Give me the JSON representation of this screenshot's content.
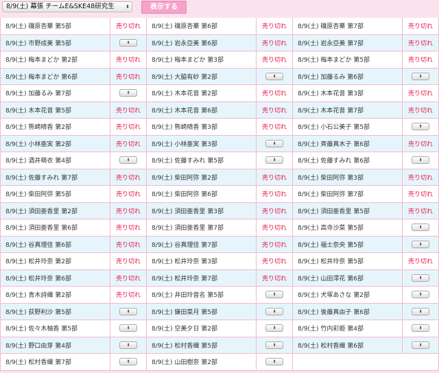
{
  "header": {
    "event_select_value": "8/9(土) 幕張 チームE&SKE48研究生",
    "select_arrow": "⬍",
    "show_button": "表示する"
  },
  "status_labels": {
    "soldout": "売り切れ",
    "select_arrow": "⬍"
  },
  "slots": [
    {
      "label": "8/9(土) 磯原杏華 第5部",
      "status": "soldout"
    },
    {
      "label": "8/9(土) 磯原杏華 第6部",
      "status": "soldout"
    },
    {
      "label": "8/9(土) 磯原杏華 第7部",
      "status": "soldout"
    },
    {
      "label": "8/9(土) 市野成美 第5部",
      "status": "select"
    },
    {
      "label": "8/9(土) 岩永亞美 第6部",
      "status": "soldout"
    },
    {
      "label": "8/9(土) 岩永亞美 第7部",
      "status": "soldout"
    },
    {
      "label": "8/9(土) 梅本まどか 第2部",
      "status": "soldout"
    },
    {
      "label": "8/9(土) 梅本まどか 第3部",
      "status": "soldout"
    },
    {
      "label": "8/9(土) 梅本まどか 第5部",
      "status": "soldout"
    },
    {
      "label": "8/9(土) 梅本まどか 第6部",
      "status": "soldout"
    },
    {
      "label": "8/9(土) 大脇有紗 第2部",
      "status": "select"
    },
    {
      "label": "8/9(土) 加藤るみ 第6部",
      "status": "select"
    },
    {
      "label": "8/9(土) 加藤るみ 第7部",
      "status": "select"
    },
    {
      "label": "8/9(土) 木本花音 第2部",
      "status": "soldout"
    },
    {
      "label": "8/9(土) 木本花音 第3部",
      "status": "soldout"
    },
    {
      "label": "8/9(土) 木本花音 第5部",
      "status": "soldout"
    },
    {
      "label": "8/9(土) 木本花音 第6部",
      "status": "soldout"
    },
    {
      "label": "8/9(土) 木本花音 第7部",
      "status": "soldout"
    },
    {
      "label": "8/9(土) 熊崎晴香 第2部",
      "status": "soldout"
    },
    {
      "label": "8/9(土) 熊崎晴香 第3部",
      "status": "soldout"
    },
    {
      "label": "8/9(土) 小石公美子 第5部",
      "status": "select"
    },
    {
      "label": "8/9(土) 小林亜実 第2部",
      "status": "soldout"
    },
    {
      "label": "8/9(土) 小林亜実 第3部",
      "status": "select"
    },
    {
      "label": "8/9(土) 斉藤真木子 第6部",
      "status": "soldout"
    },
    {
      "label": "8/9(土) 酒井萌衣 第4部",
      "status": "select"
    },
    {
      "label": "8/9(土) 佐藤すみれ 第5部",
      "status": "select"
    },
    {
      "label": "8/9(土) 佐藤すみれ 第6部",
      "status": "select"
    },
    {
      "label": "8/9(土) 佐藤すみれ 第7部",
      "status": "soldout"
    },
    {
      "label": "8/9(土) 柴田阿弥 第2部",
      "status": "soldout"
    },
    {
      "label": "8/9(土) 柴田阿弥 第3部",
      "status": "soldout"
    },
    {
      "label": "8/9(土) 柴田阿弥 第5部",
      "status": "soldout"
    },
    {
      "label": "8/9(土) 柴田阿弥 第6部",
      "status": "soldout"
    },
    {
      "label": "8/9(土) 柴田阿弥 第7部",
      "status": "soldout"
    },
    {
      "label": "8/9(土) 須田亜香里 第2部",
      "status": "soldout"
    },
    {
      "label": "8/9(土) 須田亜香里 第3部",
      "status": "soldout"
    },
    {
      "label": "8/9(土) 須田亜香里 第5部",
      "status": "soldout"
    },
    {
      "label": "8/9(土) 須田亜香里 第6部",
      "status": "soldout"
    },
    {
      "label": "8/9(土) 須田亜香里 第7部",
      "status": "soldout"
    },
    {
      "label": "8/9(土) 高寺沙菜 第5部",
      "status": "select"
    },
    {
      "label": "8/9(土) 谷真理佳 第6部",
      "status": "soldout"
    },
    {
      "label": "8/9(土) 谷真理佳 第7部",
      "status": "soldout"
    },
    {
      "label": "8/9(土) 福士奈央 第5部",
      "status": "select"
    },
    {
      "label": "8/9(土) 松井玲奈 第2部",
      "status": "soldout"
    },
    {
      "label": "8/9(土) 松井玲奈 第3部",
      "status": "soldout"
    },
    {
      "label": "8/9(土) 松井玲奈 第5部",
      "status": "soldout"
    },
    {
      "label": "8/9(土) 松井玲奈 第6部",
      "status": "soldout"
    },
    {
      "label": "8/9(土) 松井玲奈 第7部",
      "status": "soldout"
    },
    {
      "label": "8/9(土) 山田澪花 第6部",
      "status": "select"
    },
    {
      "label": "8/9(土) 青木詩織 第2部",
      "status": "soldout"
    },
    {
      "label": "8/9(土) 井田玲音名 第5部",
      "status": "select"
    },
    {
      "label": "8/9(土) 犬塚あさな 第2部",
      "status": "select"
    },
    {
      "label": "8/9(土) 荻野利沙 第5部",
      "status": "select"
    },
    {
      "label": "8/9(土) 鎌田菜月 第5部",
      "status": "select"
    },
    {
      "label": "8/9(土) 後藤真由子 第6部",
      "status": "select"
    },
    {
      "label": "8/9(土) 佐々木柚香 第5部",
      "status": "select"
    },
    {
      "label": "8/9(土) 空美夕日 第2部",
      "status": "select"
    },
    {
      "label": "8/9(土) 竹内彩姫 第4部",
      "status": "select"
    },
    {
      "label": "8/9(土) 野口由芽 第4部",
      "status": "select"
    },
    {
      "label": "8/9(土) 松村香織 第5部",
      "status": "select"
    },
    {
      "label": "8/9(土) 松村香織 第6部",
      "status": "select"
    },
    {
      "label": "8/9(土) 松村香織 第7部",
      "status": "select"
    },
    {
      "label": "8/9(土) 山田樹奈 第2部",
      "status": "select"
    }
  ]
}
